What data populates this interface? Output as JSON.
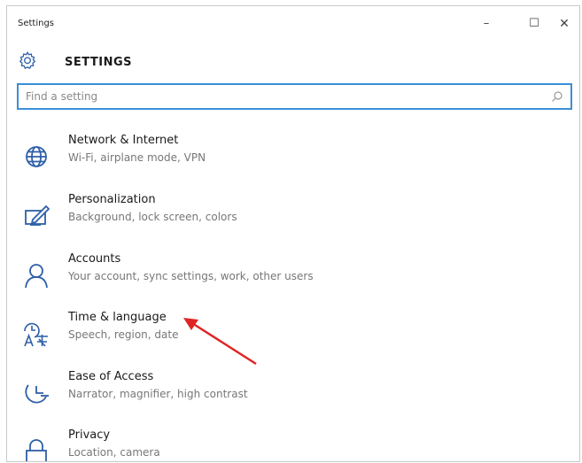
{
  "window": {
    "title": "Settings",
    "minimize_symbol": "–",
    "maximize_symbol": "☐",
    "close_symbol": "✕"
  },
  "header": {
    "title": "SETTINGS",
    "icon": "gear-icon"
  },
  "search": {
    "placeholder": "Find a setting",
    "value": "",
    "icon": "search-icon"
  },
  "categories": [
    {
      "name": "Network & Internet",
      "description": "Wi-Fi, airplane mode, VPN",
      "icon": "globe-icon"
    },
    {
      "name": "Personalization",
      "description": "Background, lock screen, colors",
      "icon": "personalization-icon"
    },
    {
      "name": "Accounts",
      "description": "Your account, sync settings, work, other users",
      "icon": "person-icon"
    },
    {
      "name": "Time & language",
      "description": "Speech, region, date",
      "icon": "time-language-icon"
    },
    {
      "name": "Ease of Access",
      "description": "Narrator, magnifier, high contrast",
      "icon": "ease-of-access-icon"
    },
    {
      "name": "Privacy",
      "description": "Location, camera",
      "icon": "lock-icon"
    }
  ],
  "annotation": {
    "type": "arrow",
    "color": "#e02424",
    "points_to": "Time & language"
  },
  "colors": {
    "accent": "#3a8fd8",
    "icon": "#2d5fa8",
    "annotation": "#e02424"
  }
}
